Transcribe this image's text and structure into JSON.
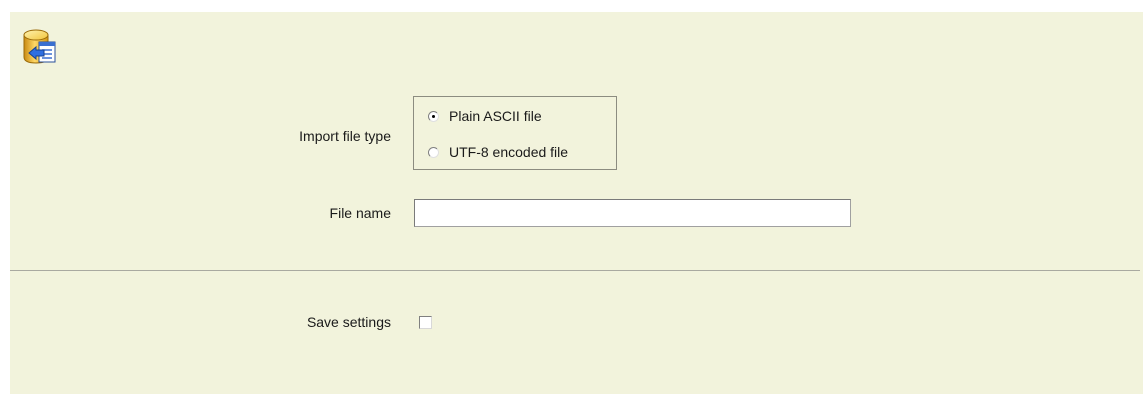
{
  "icon": {
    "name": "database-import-icon"
  },
  "form": {
    "import_file_type": {
      "label": "Import file type",
      "options": [
        {
          "label": "Plain ASCII file",
          "checked": true
        },
        {
          "label": "UTF-8 encoded file",
          "checked": false
        }
      ]
    },
    "file_name": {
      "label": "File name",
      "value": ""
    },
    "save_settings": {
      "label": "Save settings",
      "checked": false
    }
  },
  "colors": {
    "panel_background": "#f2f3dc",
    "border": "#8c8c80"
  }
}
